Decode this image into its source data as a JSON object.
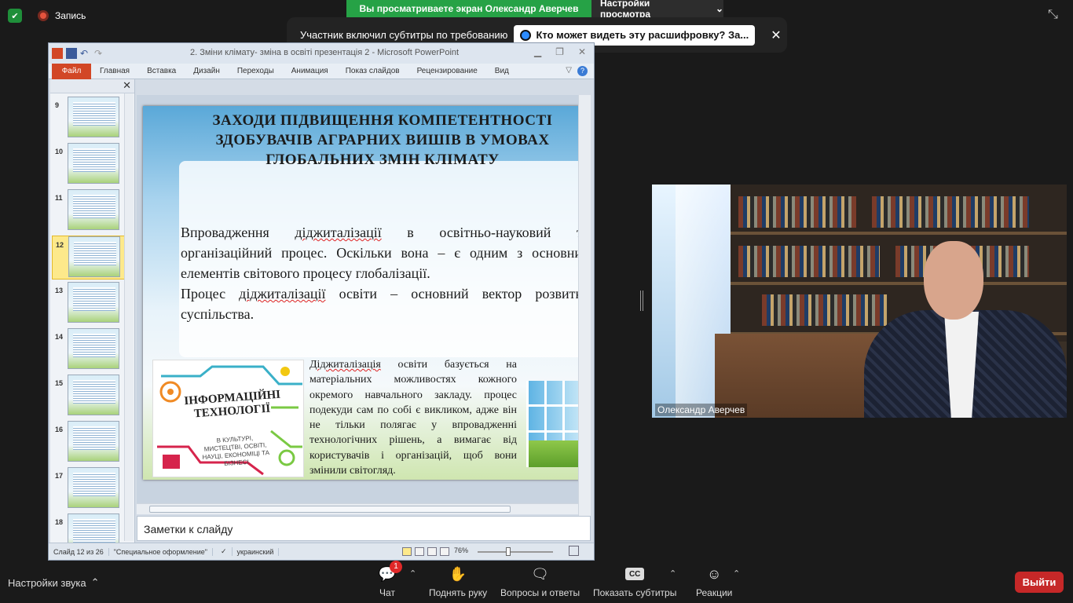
{
  "zoom_top": {
    "recording_label": "Запись",
    "viewing_banner": "Вы просматриваете экран Олександр Аверчев",
    "view_settings": "Настройки просмотра"
  },
  "caption_popup": {
    "message": "Участник включил субтитры по требованию",
    "who_button": "Кто может видеть эту расшифровку? За..."
  },
  "ppt": {
    "window_title": "2. Зміни клімату- зміна в освіті презентація 2  -  Microsoft PowerPoint",
    "tabs": [
      "Файл",
      "Главная",
      "Вставка",
      "Дизайн",
      "Переходы",
      "Анимация",
      "Показ слайдов",
      "Рецензирование",
      "Вид"
    ],
    "thumbnail_numbers": [
      "9",
      "10",
      "11",
      "12",
      "13",
      "14",
      "15",
      "16",
      "17",
      "18"
    ],
    "selected_slide": "12",
    "notes_placeholder": "Заметки к слайду",
    "status": {
      "slide": "Слайд 12 из 26",
      "theme": "\"Специальное оформление\"",
      "language": "украинский",
      "zoom": "76%"
    }
  },
  "slide": {
    "title": "ЗАХОДИ ПІДВИЩЕННЯ КОМПЕТЕНТНОСТІ ЗДОБУВАЧІВ АГРАРНИХ ВИШІВ В УМОВАХ ГЛОБАЛЬНИХ ЗМІН КЛІМАТУ",
    "p1_a": "Впровадження ",
    "p1_word": "діджиталізації",
    "p1_b": " в освітньо-науковий та організаційний процес. Оскільки вона – є одним з основних елементів світового процесу глобалізації.",
    "p2_a": "Процес ",
    "p2_word": "діджиталізації",
    "p2_b": " освіти – основний вектор розвитку суспільства.",
    "p3_word": "Діджиталізація",
    "p3_b": " освіти базується на матеріальних можливостях кожного окремого навчального закладу. процес подекуди сам по собі є викликом, адже він не тільки полягає у впровадженні технологічних рішень, а вимагає від користувачів і організацій, щоб вони змінили світогляд.",
    "info_title": "ІНФОРМАЦІЙНІ ТЕХНОЛОГІЇ",
    "info_subtitle": "В КУЛЬТУРІ, МИСТЕЦТВІ, ОСВІТІ, НАУЦІ, ЕКОНОМІЦІ ТА БІЗНЕСІ"
  },
  "video": {
    "participant_name": "Олександр Аверчев"
  },
  "toolbar": {
    "audio_settings": "Настройки звука",
    "chat": "Чат",
    "chat_badge": "1",
    "raise_hand": "Поднять руку",
    "qa": "Вопросы и ответы",
    "captions": "Показать субтитры",
    "cc": "CC",
    "reactions": "Реакции",
    "leave": "Выйти"
  },
  "colors": {
    "banner_green": "#26a246",
    "leave_red": "#c62828",
    "ppt_file_tab": "#d24726"
  }
}
